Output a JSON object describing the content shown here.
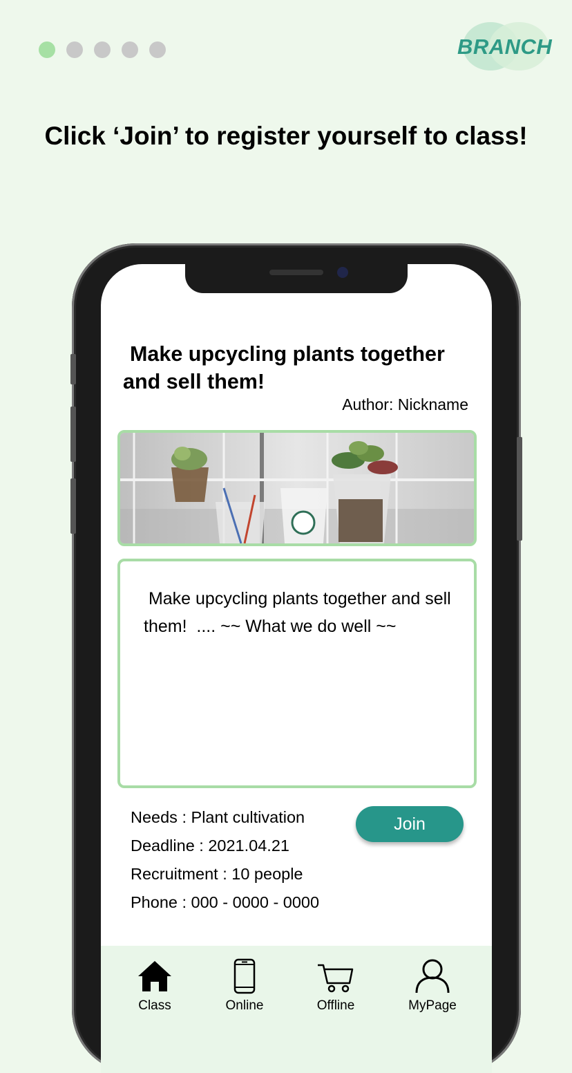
{
  "progress": {
    "total": 5,
    "current": 1
  },
  "brand": {
    "name": "BRANCH"
  },
  "headline": "Click ‘Join’ to register yourself to class!",
  "post": {
    "title_line1": "Make upcycling plants together",
    "title_line2": "and sell them!",
    "author": "Author: Nickname",
    "description": " Make upcycling plants together and sell them!  .... ~~ What we do well ~~",
    "needs": "Needs :  Plant cultivation",
    "deadline": "Deadline : 2021.04.21",
    "recruitment": "Recruitment : 10 people",
    "phone": "Phone :  000 - 0000 - 0000",
    "join_label": "Join"
  },
  "nav": {
    "items": [
      {
        "label": "Class",
        "icon": "home-icon"
      },
      {
        "label": "Online",
        "icon": "smartphone-icon"
      },
      {
        "label": "Offline",
        "icon": "cart-icon"
      },
      {
        "label": "MyPage",
        "icon": "user-icon"
      }
    ]
  },
  "colors": {
    "accent": "#27968a",
    "border_green": "#a8dca6",
    "background": "#eef8ec"
  }
}
